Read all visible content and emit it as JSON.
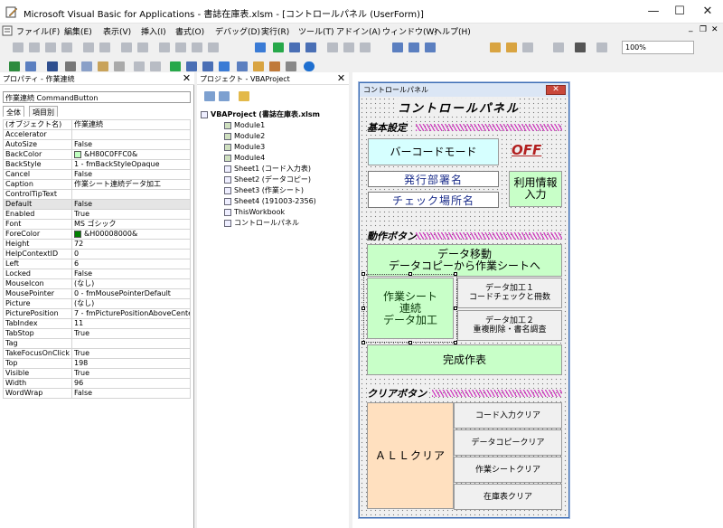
{
  "window": {
    "title": "Microsoft Visual Basic for Applications - 書誌在庫表.xlsm - [コントロールパネル (UserForm)]",
    "min": "—",
    "max": "☐",
    "close": "✕"
  },
  "menu": [
    "ファイル(F)",
    "編集(E)",
    "表示(V)",
    "挿入(I)",
    "書式(O)",
    "デバッグ(D)",
    "実行(R)",
    "ツール(T)",
    "アドイン(A)",
    "ウィンドウ(W)",
    "ヘルプ(H)"
  ],
  "toolbar": {
    "zoom": "100%",
    "doc_min": "_",
    "doc_max": "❐",
    "doc_close": "✕"
  },
  "properties": {
    "title": "プロパティ - 作業連続",
    "object": "作業連続 CommandButton",
    "tabs": [
      "全体",
      "項目別"
    ],
    "rows": [
      [
        "(オブジェクト名)",
        "作業連続"
      ],
      [
        "Accelerator",
        ""
      ],
      [
        "AutoSize",
        "False"
      ],
      [
        "BackColor",
        "&H80C0FFC0&"
      ],
      [
        "BackStyle",
        "1 - fmBackStyleOpaque"
      ],
      [
        "Cancel",
        "False"
      ],
      [
        "Caption",
        "作業シート連続データ加工"
      ],
      [
        "ControlTipText",
        ""
      ],
      [
        "Default",
        "False"
      ],
      [
        "Enabled",
        "True"
      ],
      [
        "Font",
        "MS ゴシック"
      ],
      [
        "ForeColor",
        "&H00008000&"
      ],
      [
        "Height",
        "72"
      ],
      [
        "HelpContextID",
        "0"
      ],
      [
        "Left",
        "6"
      ],
      [
        "Locked",
        "False"
      ],
      [
        "MouseIcon",
        "(なし)"
      ],
      [
        "MousePointer",
        "0 - fmMousePointerDefault"
      ],
      [
        "Picture",
        "(なし)"
      ],
      [
        "PicturePosition",
        "7 - fmPicturePositionAboveCente"
      ],
      [
        "TabIndex",
        "11"
      ],
      [
        "TabStop",
        "True"
      ],
      [
        "Tag",
        ""
      ],
      [
        "TakeFocusOnClick",
        "True"
      ],
      [
        "Top",
        "198"
      ],
      [
        "Visible",
        "True"
      ],
      [
        "Width",
        "96"
      ],
      [
        "WordWrap",
        "False"
      ]
    ],
    "colors": {
      "backcolor": "#c0ffc0",
      "forecolor": "#008000"
    }
  },
  "project": {
    "title": "プロジェクト - VBAProject",
    "root": "VBAProject (書誌在庫表.xlsm",
    "items": [
      "Module1",
      "Module2",
      "Module3",
      "Module4",
      "Sheet1 (コード入力表)",
      "Sheet2 (データコピー)",
      "Sheet3 (作業シート)",
      "Sheet4 (191003-2356)",
      "ThisWorkbook",
      "コントロールパネル"
    ]
  },
  "form": {
    "title": "コントロールパネル",
    "close": "✕",
    "heading": "コントロールパネル",
    "basic_label": "基本設定",
    "barcode_button": "バーコードモード",
    "off_label": "OFF",
    "dept_label": "発行部署名",
    "check_label": "チェック場所名",
    "userinfo_button": "利用情報入力",
    "action_label": "動作ボタン",
    "data_move_button": "データ移動\nデータコピーから作業シートへ",
    "continuous_button": "作業シート\n連続\nデータ加工",
    "process1_button": "データ加工１\nコードチェックと冊数",
    "process2_button": "データ加工２\n重複削除・書名調査",
    "complete_button": "完成作表",
    "clear_label": "クリアボタン",
    "all_clear_button": "ＡＬＬクリア",
    "code_clear_button": "コード入力クリア",
    "datacopy_clear_button": "データコピークリア",
    "worksheet_clear_button": "作業シートクリア",
    "inventory_clear_button": "在庫表クリア"
  }
}
